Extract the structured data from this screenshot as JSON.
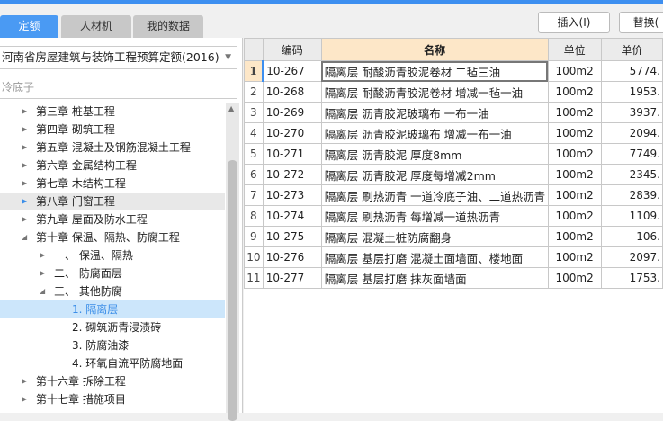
{
  "tabs": [
    {
      "label": "定额"
    },
    {
      "label": "人材机"
    },
    {
      "label": "我的数据"
    }
  ],
  "toolbar": {
    "insert": "插入(I)",
    "replace": "替换("
  },
  "left": {
    "quota_library": "河南省房屋建筑与装饰工程预算定额(2016)",
    "search_value": "冷底子",
    "tree": [
      {
        "label": "第三章 桩基工程",
        "level": 0,
        "state": "collapsed"
      },
      {
        "label": "第四章 砌筑工程",
        "level": 0,
        "state": "collapsed"
      },
      {
        "label": "第五章 混凝土及钢筋混凝土工程",
        "level": 0,
        "state": "collapsed"
      },
      {
        "label": "第六章 金属结构工程",
        "level": 0,
        "state": "collapsed"
      },
      {
        "label": "第七章 木结构工程",
        "level": 0,
        "state": "collapsed"
      },
      {
        "label": "第八章 门窗工程",
        "level": 0,
        "state": "collapsed",
        "hover": true
      },
      {
        "label": "第九章 屋面及防水工程",
        "level": 0,
        "state": "collapsed"
      },
      {
        "label": "第十章 保温、隔热、防腐工程",
        "level": 0,
        "state": "expanded"
      },
      {
        "label": "一、 保温、隔热",
        "level": 1,
        "state": "collapsed"
      },
      {
        "label": "二、 防腐面层",
        "level": 1,
        "state": "collapsed"
      },
      {
        "label": "三、 其他防腐",
        "level": 1,
        "state": "expanded"
      },
      {
        "label": "1. 隔离层",
        "level": 2,
        "state": "leaf",
        "selected": true
      },
      {
        "label": "2. 砌筑沥青浸渍砖",
        "level": 2,
        "state": "leaf"
      },
      {
        "label": "3. 防腐油漆",
        "level": 2,
        "state": "leaf"
      },
      {
        "label": "4. 环氧自流平防腐地面",
        "level": 2,
        "state": "leaf"
      },
      {
        "label": "第十六章 拆除工程",
        "level": 0,
        "state": "collapsed"
      },
      {
        "label": "第十七章 措施项目",
        "level": 0,
        "state": "collapsed"
      }
    ]
  },
  "grid": {
    "headers": {
      "code": "编码",
      "name": "名称",
      "unit": "单位",
      "price": "单价"
    },
    "rows": [
      {
        "n": "1",
        "code": "10-267",
        "name": "隔离层 耐酸沥青胶泥卷材 二毡三油",
        "unit": "100m2",
        "price": "5774."
      },
      {
        "n": "2",
        "code": "10-268",
        "name": "隔离层 耐酸沥青胶泥卷材 增减一毡一油",
        "unit": "100m2",
        "price": "1953."
      },
      {
        "n": "3",
        "code": "10-269",
        "name": "隔离层 沥青胶泥玻璃布 一布一油",
        "unit": "100m2",
        "price": "3937."
      },
      {
        "n": "4",
        "code": "10-270",
        "name": "隔离层 沥青胶泥玻璃布 增减一布一油",
        "unit": "100m2",
        "price": "2094."
      },
      {
        "n": "5",
        "code": "10-271",
        "name": "隔离层 沥青胶泥 厚度8mm",
        "unit": "100m2",
        "price": "7749."
      },
      {
        "n": "6",
        "code": "10-272",
        "name": "隔离层 沥青胶泥 厚度每增减2mm",
        "unit": "100m2",
        "price": "2345."
      },
      {
        "n": "7",
        "code": "10-273",
        "name": "隔离层 刷热沥青 一道冷底子油、二道热沥青",
        "unit": "100m2",
        "price": "2839."
      },
      {
        "n": "8",
        "code": "10-274",
        "name": "隔离层 刷热沥青 每增减一道热沥青",
        "unit": "100m2",
        "price": "1109."
      },
      {
        "n": "9",
        "code": "10-275",
        "name": "隔离层 混凝土桩防腐翻身",
        "unit": "100m2",
        "price": "106."
      },
      {
        "n": "10",
        "code": "10-276",
        "name": "隔离层 基层打磨 混凝土面墙面、楼地面",
        "unit": "100m2",
        "price": "2097."
      },
      {
        "n": "11",
        "code": "10-277",
        "name": "隔离层 基层打磨 抹灰面墙面",
        "unit": "100m2",
        "price": "1753."
      }
    ]
  }
}
